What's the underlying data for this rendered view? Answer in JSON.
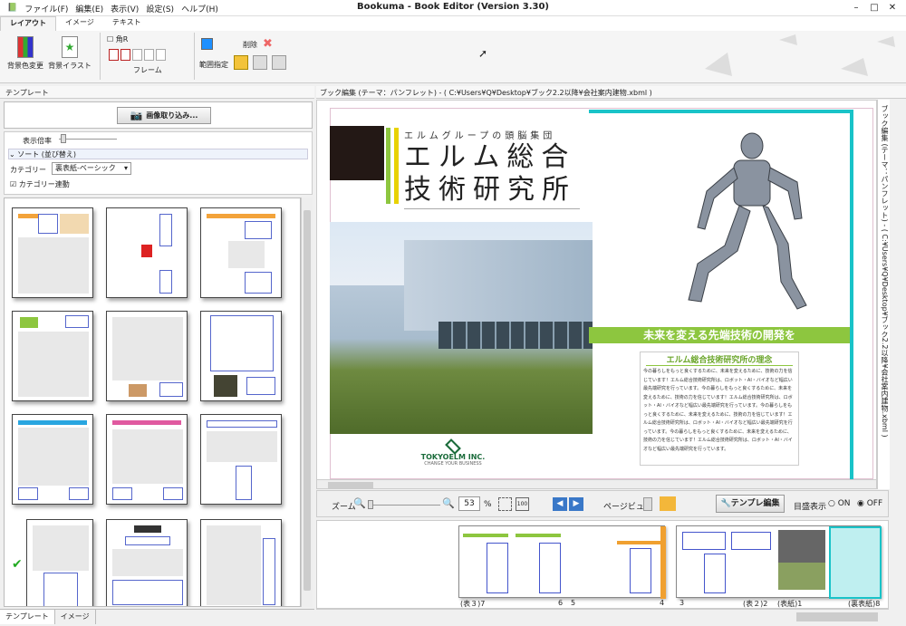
{
  "app": {
    "title": "Bookuma - Book Editor (Version 3.30)"
  },
  "menu": [
    {
      "label": "ファイル(F)"
    },
    {
      "label": "編集(E)"
    },
    {
      "label": "表示(V)"
    },
    {
      "label": "設定(S)"
    },
    {
      "label": "ヘルプ(H)"
    }
  ],
  "ribbon_tabs": [
    "レイアウト",
    "イメージ",
    "テキスト"
  ],
  "ribbon": {
    "bg_color": "背景色変更",
    "bg_illust": "背景イラスト",
    "corner": "角R",
    "frame": "フレーム",
    "delete": "削除",
    "range": "範囲指定"
  },
  "left_panel": {
    "header": "テンプレート",
    "import_button": "画像取り込み...",
    "zoom_label": "表示倍率",
    "sort_label": "ソート (並び替え)",
    "category_label": "カテゴリー",
    "category_value": "裏表紙-ベーシック",
    "category_link": "カテゴリー連動",
    "tabs": [
      "テンプレート",
      "イメージ"
    ]
  },
  "editor": {
    "header": "ブック編集 (テーマ：パンフレット) - ( C:¥Users¥Q¥Desktop¥ブック2.2以降¥会社案内建物.xbml )",
    "side_text": "ブック編集 (テーマ：パンフレット) - ( C:¥Users¥Q¥Desktop¥ブック2.2以降¥会社案内建物.xbml )"
  },
  "page": {
    "tagline": "エルムグループの頭脳集団",
    "title_line1": "エルム総合",
    "title_line2": "技術研究所",
    "green_banner": "未来を変える先端技術の開発を",
    "section_title": "エルム総合技術研究所の理念",
    "body": "今の暮らしをもっと良くするために、未来を変えるために、技術の力を信じています！エルム総合技術研究所は、ロボット・AI・バイオなど幅広い最先端研究を行っています。今の暮らしをもっと良くするために、未来を変えるために、技術の力を信じています！エルム総合技術研究所は、ロボット・AI・バイオなど幅広い最先端研究を行っています。今の暮らしをもっと良くするために、未来を変えるために、技術の力を信じています！エルム総合技術研究所は、ロボット・AI・バイオなど幅広い最先端研究を行っています。今の暮らしをもっと良くするために、未来を変えるために、技術の力を信じています！エルム総合技術研究所は、ロボット・AI・バイオなど幅広い最先端研究を行っています。",
    "logo_name": "TOKYOELM INC.",
    "logo_sub": "CHANGE YOUR BUSINESS",
    "accent_green": "#8dc63f",
    "accent_cyan": "#19c3c8"
  },
  "zoombar": {
    "zoom_label": "ズーム",
    "zoom_value": "53",
    "percent": "%",
    "page_view": "ページビュー",
    "template_edit": "テンプレ編集",
    "grid_label": "目盛表示",
    "on": "ON",
    "off": "OFF"
  },
  "strip_labels": [
    "(表３)7",
    "6",
    "5",
    "4",
    "3",
    "(表２)2",
    "(表紙)1",
    "(裏表紙)8"
  ]
}
